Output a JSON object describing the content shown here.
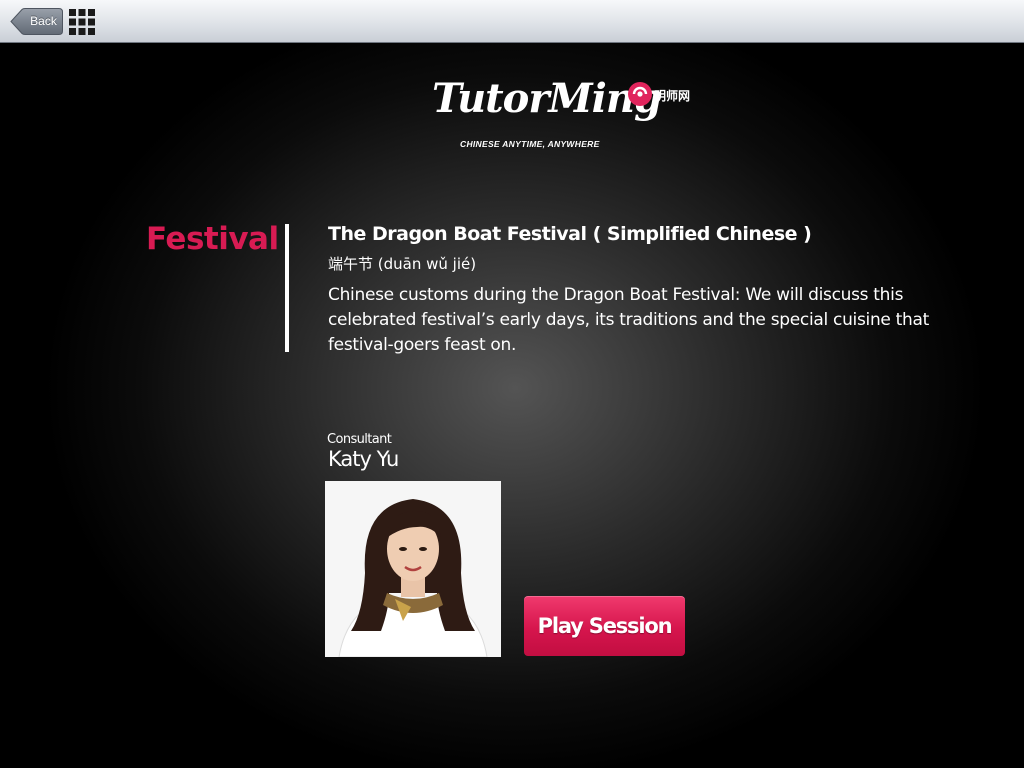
{
  "toolbar": {
    "back_label": "Back",
    "menu_icon": "grid-icon"
  },
  "logo": {
    "wordmark": "TutorMing",
    "tagline": "CHINESE ANYTIME, ANYWHERE",
    "chinese_name": "明师网",
    "mark_icon": "tutorming-mark-icon"
  },
  "course": {
    "category": "Festival",
    "title": "The Dragon Boat Festival ( Simplified Chinese )",
    "pinyin": "端午节 (duān wǔ jié)",
    "description": "Chinese customs during the Dragon Boat Festival: We will discuss this celebrated festival’s early days, its traditions and the special cuisine that festival-goers feast on."
  },
  "consultant": {
    "label": "Consultant",
    "name": "Katy Yu",
    "photo_icon": "consultant-photo"
  },
  "actions": {
    "play_label": "Play Session"
  },
  "colors": {
    "accent": "#d81b53",
    "background": "#000000",
    "toolbar": "#dfe3e8"
  }
}
